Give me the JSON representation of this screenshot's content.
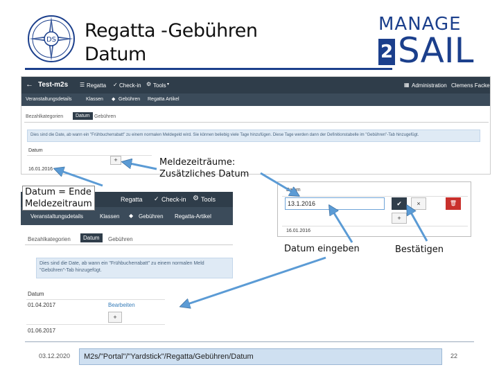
{
  "slide": {
    "title_line1": "Regatta -Gebühren",
    "title_line2": "Datum",
    "logo_letters": "DS",
    "brand_top": "MANAGE",
    "brand_digit": "2",
    "brand_bottom": "SAIL"
  },
  "main_screenshot": {
    "back_arrow": "←",
    "app_title": "Test-m2s",
    "nav": {
      "regatta": "Regatta",
      "check_in": "Check-in",
      "tools": "Tools",
      "administration": "Administration",
      "user": "Clemens Fackeldey"
    },
    "subnav": {
      "veranstaltungsdetails": "Veranstaltungsdetails",
      "klassen": "Klassen",
      "gebuehren": "Gebühren",
      "regatta_artikel": "Regatta Artikel"
    },
    "tabs": {
      "bezahlkategorien": "Bezahlkategorien",
      "datum": "Datum",
      "gebuehren": "Gebühren"
    },
    "info_text": "Dies sind die Date, ab wann ein \"Frühbucherrabatt\" zu einem normalen Meldegeld wird. Sie können beliebig viele Tage hinzufügen. Diese Tage werden dann der Definitionstabelle im \"Gebühren\"-Tab hinzugefügt.",
    "col_datum": "Datum",
    "plus": "+",
    "date_value": "16.01.2016"
  },
  "input_screenshot": {
    "label": "Datum",
    "input_value": "13.1.2016",
    "confirm_glyph": "✔",
    "cancel_glyph": "×",
    "delete_glyph": "🗑",
    "plus": "+",
    "date_value": "16.01.2016"
  },
  "nav_crop": {
    "regatta": "Regatta",
    "check_in": "Check-in",
    "tools": "Tools",
    "veranstaltungsdetails": "Veranstaltungsdetails",
    "klassen": "Klassen",
    "gebuehren": "Gebühren",
    "regatta_artikel": "Regatta-Artikel"
  },
  "lower_screenshot": {
    "tabs": {
      "bezahlkategorien": "Bezahlkategorien",
      "datum": "Datum",
      "gebuehren": "Gebühren"
    },
    "info_line1": "Dies sind die Date, ab wann ein \"Frühbucherrabatt\" zu einem normalen Meld",
    "info_line2": "\"Gebühren\"-Tab hinzugefügt.",
    "col_datum": "Datum",
    "row1_date": "01.04.2017",
    "row1_action": "Bearbeiten",
    "plus": "+",
    "row2_date": "01.06.2017"
  },
  "callouts": {
    "meldezeitraeume_1": "Meldezeiträume:",
    "meldezeitraeume_2": "Zusätzliches Datum",
    "datum_ende_1": "Datum = Ende",
    "datum_ende_2": "Meldezeitraum",
    "datum_eingeben": "Datum eingeben",
    "bestaetigen": "Bestätigen"
  },
  "footer": {
    "date": "03.12.2020",
    "path": "M2s/\"Portal\"/\"Yardstick\"/Regatta/Gebühren/Datum",
    "page": "22"
  },
  "colors": {
    "navbar": "#2f3d4a",
    "brand_blue": "#1b3f8c",
    "arrow_blue": "#5b9bd5",
    "confirm_button": "#2f3d4a",
    "delete_button": "#c9302c",
    "info_box": "#dfeaf5"
  },
  "icons": [
    "compass-rose-logo",
    "back-arrow-icon",
    "list-icon",
    "check-icon",
    "gear-icon",
    "tag-icon",
    "grid-icon",
    "chevron-down-icon",
    "plus-icon",
    "confirm-check-icon",
    "cancel-icon",
    "trash-icon"
  ]
}
